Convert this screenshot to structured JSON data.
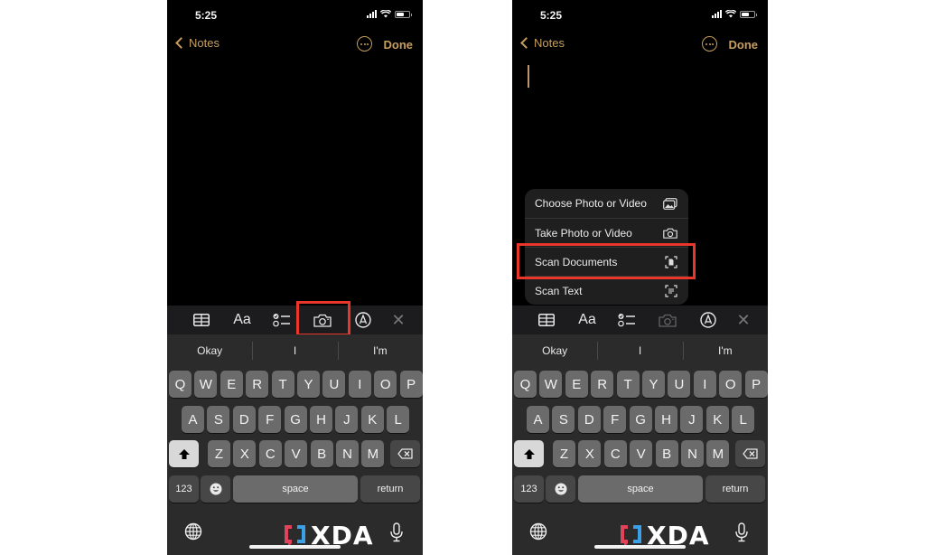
{
  "screens": [
    {
      "status": {
        "time": "5:25",
        "battery_percent": 60
      },
      "nav": {
        "back_label": "Notes",
        "done_label": "Done"
      },
      "note_body": "",
      "format_bar": {
        "items": [
          "table-icon",
          "Aa",
          "checklist-icon",
          "camera-icon",
          "markup-icon",
          "close-icon"
        ],
        "highlighted": "camera-icon"
      },
      "predictions": [
        "Okay",
        "I",
        "I'm"
      ]
    },
    {
      "status": {
        "time": "5:25",
        "battery_percent": 60
      },
      "nav": {
        "back_label": "Notes",
        "done_label": "Done"
      },
      "note_body": "",
      "camera_menu": {
        "items": [
          {
            "label": "Choose Photo or Video",
            "icon": "photo-library-icon"
          },
          {
            "label": "Take Photo or Video",
            "icon": "camera-icon"
          },
          {
            "label": "Scan Documents",
            "icon": "scan-document-icon"
          },
          {
            "label": "Scan Text",
            "icon": "scan-text-icon"
          }
        ],
        "highlighted": "Scan Documents"
      },
      "format_bar": {
        "items": [
          "table-icon",
          "Aa",
          "checklist-icon",
          "camera-icon",
          "markup-icon",
          "close-icon"
        ]
      },
      "predictions": [
        "Okay",
        "I",
        "I'm"
      ]
    }
  ],
  "keyboard": {
    "row1": [
      "Q",
      "W",
      "E",
      "R",
      "T",
      "Y",
      "U",
      "I",
      "O",
      "P"
    ],
    "row2": [
      "A",
      "S",
      "D",
      "F",
      "G",
      "H",
      "J",
      "K",
      "L"
    ],
    "row3": [
      "Z",
      "X",
      "C",
      "V",
      "B",
      "N",
      "M"
    ],
    "numbers_label": "123",
    "space_label": "space",
    "return_label": "return"
  },
  "watermark": {
    "text": "XDA"
  },
  "colors": {
    "accent": "#c79f5d",
    "highlight": "#e8362a",
    "keyboard_bg": "#2b2b2b",
    "key": "#6b6b6b"
  }
}
